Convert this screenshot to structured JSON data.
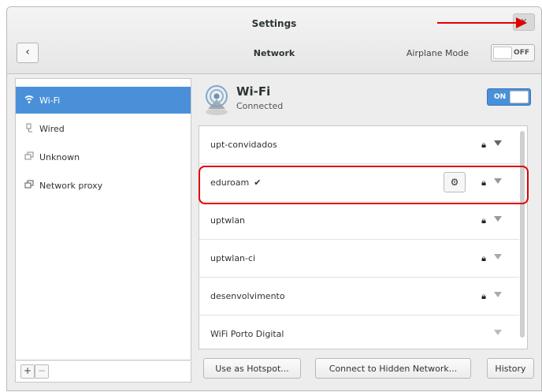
{
  "window": {
    "title": "Settings",
    "subtitle": "Network",
    "back_icon": "chevron-left-icon"
  },
  "airplane": {
    "label": "Airplane Mode",
    "toggle_label": "OFF",
    "state": "off"
  },
  "sidebar": {
    "items": [
      {
        "label": "Wi-Fi",
        "icon": "wifi-icon",
        "active": true
      },
      {
        "label": "Wired",
        "icon": "wired-icon",
        "active": false
      },
      {
        "label": "Unknown",
        "icon": "network-icon",
        "active": false
      },
      {
        "label": "Network proxy",
        "icon": "proxy-icon",
        "active": false
      }
    ],
    "add_label": "+",
    "remove_label": "−"
  },
  "wifi": {
    "title": "Wi-Fi",
    "status": "Connected",
    "toggle_label": "ON",
    "state": "on"
  },
  "networks": [
    {
      "name": "upt-convidados",
      "locked": true,
      "connected": false
    },
    {
      "name": "eduroam",
      "locked": true,
      "connected": true
    },
    {
      "name": "uptwlan",
      "locked": true,
      "connected": false
    },
    {
      "name": "uptwlan-ci",
      "locked": true,
      "connected": false
    },
    {
      "name": "desenvolvimento",
      "locked": true,
      "connected": false
    },
    {
      "name": "WiFi Porto Digital",
      "locked": false,
      "connected": false
    }
  ],
  "buttons": {
    "hotspot": "Use as Hotspot...",
    "hidden": "Connect to Hidden Network...",
    "history": "History"
  },
  "colors": {
    "accent": "#4a90d9",
    "annotation": "#e00000"
  }
}
